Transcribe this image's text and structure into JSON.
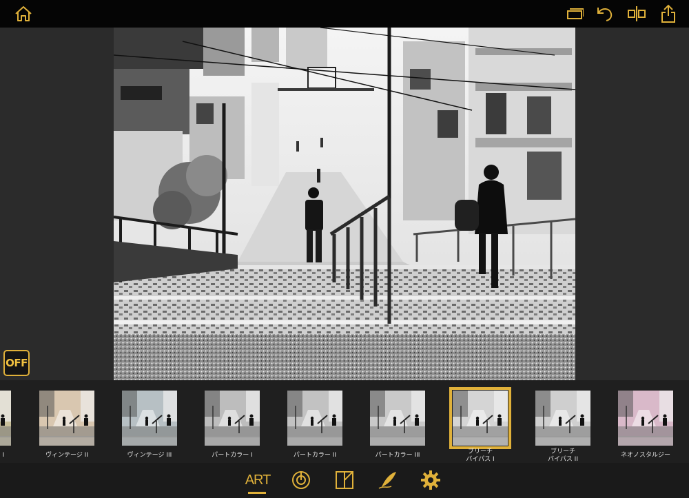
{
  "colors": {
    "accent": "#e0b13a",
    "topbar": "#050505",
    "strip": "#1f1f1f",
    "bottombar": "#1a1a1a"
  },
  "topbar": {
    "icons": [
      "home-icon",
      "crop-icon",
      "undo-icon",
      "compare-icon",
      "share-icon"
    ]
  },
  "off_toggle": {
    "label": "OFF"
  },
  "filters": [
    {
      "label": "I",
      "selected": false,
      "tint": "#c8bf9a"
    },
    {
      "label": "ヴィンテージ II",
      "selected": false,
      "tint": "#d9c7b0"
    },
    {
      "label": "ヴィンテージ III",
      "selected": false,
      "tint": "#b7c0c4"
    },
    {
      "label": "パートカラー I",
      "selected": false,
      "tint": "#bdbdbd"
    },
    {
      "label": "パートカラー II",
      "selected": false,
      "tint": "#c2c2c2"
    },
    {
      "label": "パートカラー III",
      "selected": false,
      "tint": "#c9c9c9"
    },
    {
      "label": "ブリーチ\nバイパス I",
      "selected": true,
      "tint": "#d5d5d5"
    },
    {
      "label": "ブリーチ\nバイパス II",
      "selected": false,
      "tint": "#cfcfcf"
    },
    {
      "label": "ネオノスタルジー",
      "selected": false,
      "tint": "#d9b9c9"
    }
  ],
  "bottombar": {
    "art_label": "ART",
    "icons": [
      "art-tab",
      "adjust-icon",
      "frame-icon",
      "signature-icon",
      "settings-icon"
    ]
  }
}
